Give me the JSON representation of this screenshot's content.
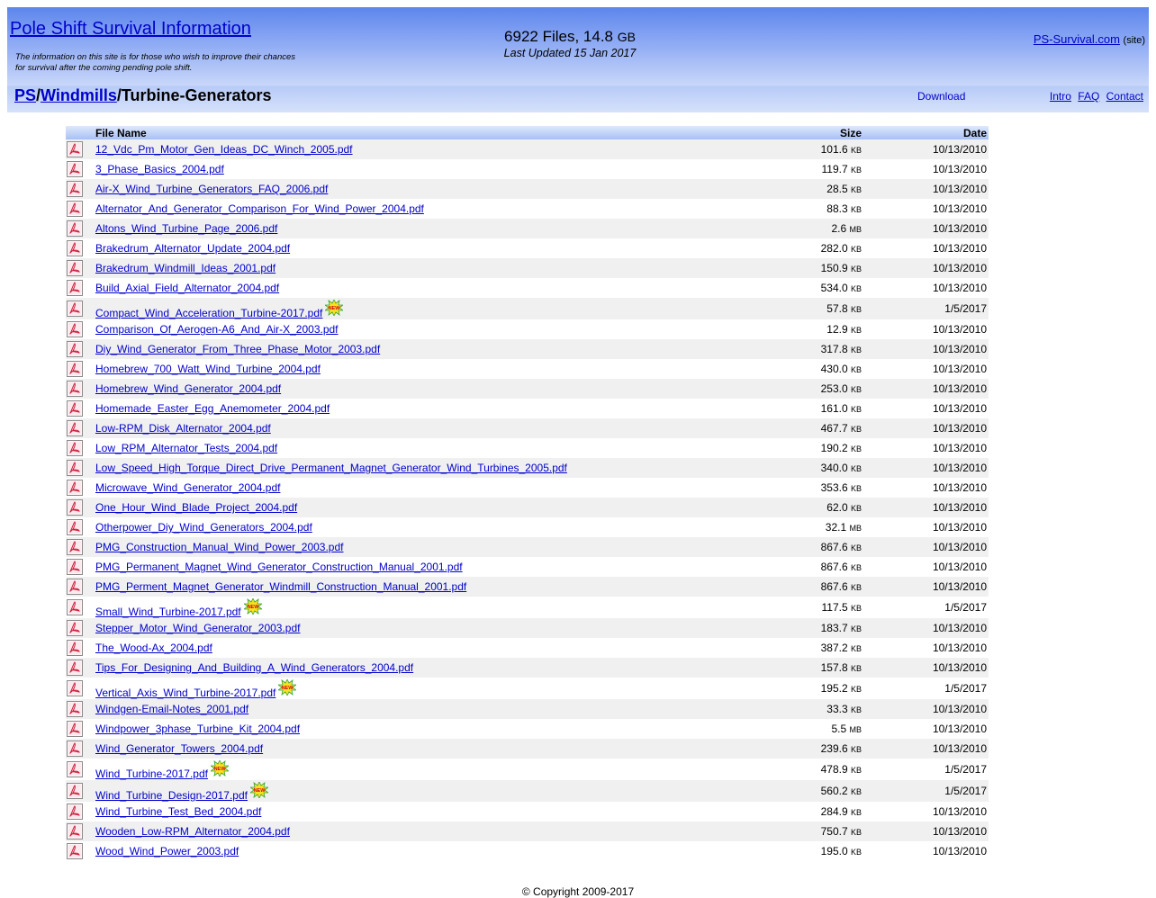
{
  "header": {
    "site_title": "Pole Shift Survival Information",
    "tagline": "The information on this site is for those who wish to improve their chances for survival after the coming pending pole shift.",
    "stats_count": "6922 Files, 14.8",
    "stats_unit": "GB",
    "last_updated": "Last Updated 15 Jan 2017",
    "site_link": "PS-Survival.com",
    "site_suffix": "(site)"
  },
  "breadcrumb": {
    "root": "PS",
    "sep1": "/",
    "parent": "Windmills",
    "current": "/Turbine-Generators"
  },
  "nav": {
    "download": "Download",
    "intro": "Intro",
    "faq": "FAQ",
    "contact": "Contact"
  },
  "table": {
    "col_name": "File Name",
    "col_size": "Size",
    "col_date": "Date",
    "files": [
      {
        "name": "12_Vdc_Pm_Motor_Gen_Ideas_DC_Winch_2005.pdf",
        "size": "101.6",
        "unit": "KB",
        "date": "10/13/2010",
        "new": false
      },
      {
        "name": "3_Phase_Basics_2004.pdf",
        "size": "119.7",
        "unit": "KB",
        "date": "10/13/2010",
        "new": false
      },
      {
        "name": "Air-X_Wind_Turbine_Generators_FAQ_2006.pdf",
        "size": "28.5",
        "unit": "KB",
        "date": "10/13/2010",
        "new": false
      },
      {
        "name": "Alternator_And_Generator_Comparison_For_Wind_Power_2004.pdf",
        "size": "88.3",
        "unit": "KB",
        "date": "10/13/2010",
        "new": false
      },
      {
        "name": "Altons_Wind_Turbine_Page_2006.pdf",
        "size": "2.6",
        "unit": "MB",
        "date": "10/13/2010",
        "new": false
      },
      {
        "name": "Brakedrum_Alternator_Update_2004.pdf",
        "size": "282.0",
        "unit": "KB",
        "date": "10/13/2010",
        "new": false
      },
      {
        "name": "Brakedrum_Windmill_Ideas_2001.pdf",
        "size": "150.9",
        "unit": "KB",
        "date": "10/13/2010",
        "new": false
      },
      {
        "name": "Build_Axial_Field_Alternator_2004.pdf",
        "size": "534.0",
        "unit": "KB",
        "date": "10/13/2010",
        "new": false
      },
      {
        "name": "Compact_Wind_Acceleration_Turbine-2017.pdf",
        "size": "57.8",
        "unit": "KB",
        "date": "1/5/2017",
        "new": true
      },
      {
        "name": "Comparison_Of_Aerogen-A6_And_Air-X_2003.pdf",
        "size": "12.9",
        "unit": "KB",
        "date": "10/13/2010",
        "new": false
      },
      {
        "name": "Diy_Wind_Generator_From_Three_Phase_Motor_2003.pdf",
        "size": "317.8",
        "unit": "KB",
        "date": "10/13/2010",
        "new": false
      },
      {
        "name": "Homebrew_700_Watt_Wind_Turbine_2004.pdf",
        "size": "430.0",
        "unit": "KB",
        "date": "10/13/2010",
        "new": false
      },
      {
        "name": "Homebrew_Wind_Generator_2004.pdf",
        "size": "253.0",
        "unit": "KB",
        "date": "10/13/2010",
        "new": false
      },
      {
        "name": "Homemade_Easter_Egg_Anemometer_2004.pdf",
        "size": "161.0",
        "unit": "KB",
        "date": "10/13/2010",
        "new": false
      },
      {
        "name": "Low-RPM_Disk_Alternator_2004.pdf",
        "size": "467.7",
        "unit": "KB",
        "date": "10/13/2010",
        "new": false
      },
      {
        "name": "Low_RPM_Alternator_Tests_2004.pdf",
        "size": "190.2",
        "unit": "KB",
        "date": "10/13/2010",
        "new": false
      },
      {
        "name": "Low_Speed_High_Torque_Direct_Drive_Permanent_Magnet_Generator_Wind_Turbines_2005.pdf",
        "size": "340.0",
        "unit": "KB",
        "date": "10/13/2010",
        "new": false
      },
      {
        "name": "Microwave_Wind_Generator_2004.pdf",
        "size": "353.6",
        "unit": "KB",
        "date": "10/13/2010",
        "new": false
      },
      {
        "name": "One_Hour_Wind_Blade_Project_2004.pdf",
        "size": "62.0",
        "unit": "KB",
        "date": "10/13/2010",
        "new": false
      },
      {
        "name": "Otherpower_Diy_Wind_Generators_2004.pdf",
        "size": "32.1",
        "unit": "MB",
        "date": "10/13/2010",
        "new": false
      },
      {
        "name": "PMG_Construction_Manual_Wind_Power_2003.pdf",
        "size": "867.6",
        "unit": "KB",
        "date": "10/13/2010",
        "new": false
      },
      {
        "name": "PMG_Permanent_Magnet_Wind_Generator_Construction_Manual_2001.pdf",
        "size": "867.6",
        "unit": "KB",
        "date": "10/13/2010",
        "new": false
      },
      {
        "name": "PMG_Perment_Magnet_Generator_Windmill_Construction_Manual_2001.pdf",
        "size": "867.6",
        "unit": "KB",
        "date": "10/13/2010",
        "new": false
      },
      {
        "name": "Small_Wind_Turbine-2017.pdf",
        "size": "117.5",
        "unit": "KB",
        "date": "1/5/2017",
        "new": true
      },
      {
        "name": "Stepper_Motor_Wind_Generator_2003.pdf",
        "size": "183.7",
        "unit": "KB",
        "date": "10/13/2010",
        "new": false
      },
      {
        "name": "The_Wood-Ax_2004.pdf",
        "size": "387.2",
        "unit": "KB",
        "date": "10/13/2010",
        "new": false
      },
      {
        "name": "Tips_For_Designing_And_Building_A_Wind_Generators_2004.pdf",
        "size": "157.8",
        "unit": "KB",
        "date": "10/13/2010",
        "new": false
      },
      {
        "name": "Vertical_Axis_Wind_Turbine-2017.pdf",
        "size": "195.2",
        "unit": "KB",
        "date": "1/5/2017",
        "new": true
      },
      {
        "name": "Windgen-Email-Notes_2001.pdf",
        "size": "33.3",
        "unit": "KB",
        "date": "10/13/2010",
        "new": false
      },
      {
        "name": "Windpower_3phase_Turbine_Kit_2004.pdf",
        "size": "5.5",
        "unit": "MB",
        "date": "10/13/2010",
        "new": false
      },
      {
        "name": "Wind_Generator_Towers_2004.pdf",
        "size": "239.6",
        "unit": "KB",
        "date": "10/13/2010",
        "new": false
      },
      {
        "name": "Wind_Turbine-2017.pdf",
        "size": "478.9",
        "unit": "KB",
        "date": "1/5/2017",
        "new": true
      },
      {
        "name": "Wind_Turbine_Design-2017.pdf",
        "size": "560.2",
        "unit": "KB",
        "date": "1/5/2017",
        "new": true
      },
      {
        "name": "Wind_Turbine_Test_Bed_2004.pdf",
        "size": "284.9",
        "unit": "KB",
        "date": "10/13/2010",
        "new": false
      },
      {
        "name": "Wooden_Low-RPM_Alternator_2004.pdf",
        "size": "750.7",
        "unit": "KB",
        "date": "10/13/2010",
        "new": false
      },
      {
        "name": "Wood_Wind_Power_2003.pdf",
        "size": "195.0",
        "unit": "KB",
        "date": "10/13/2010",
        "new": false
      }
    ]
  },
  "icons": {
    "file": "pdf-icon",
    "badge": "new-badge-icon"
  },
  "footer": {
    "copyright": "© Copyright 2009-2017"
  },
  "colors": {
    "link": "#0000cc",
    "header_top": "#5c86ec",
    "header_bottom": "#d6e1fb",
    "row_alt": "#f0f0f0"
  }
}
